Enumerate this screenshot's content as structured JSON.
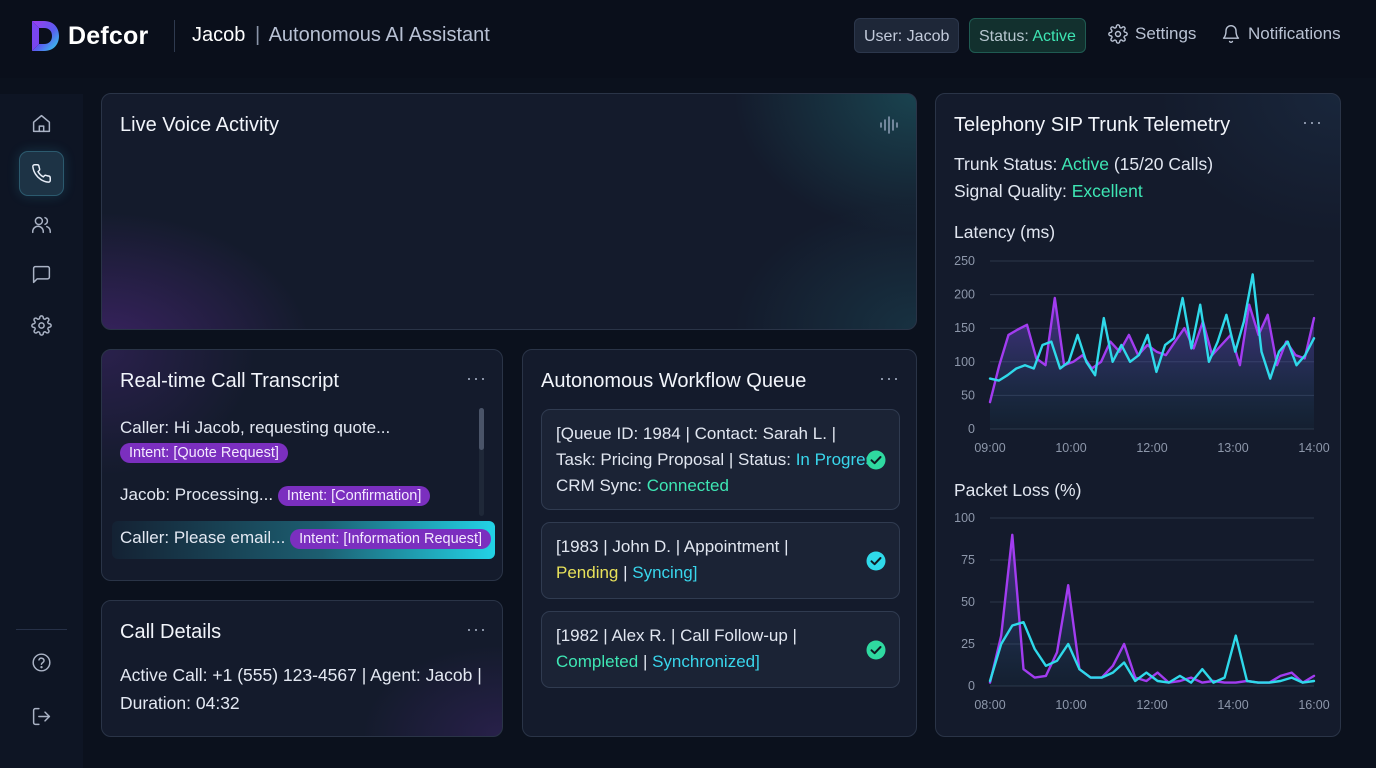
{
  "header": {
    "brand": "Defcor",
    "agent_name": "Jacob",
    "separator": "|",
    "subtitle": "Autonomous AI Assistant",
    "user_pill": "User: Jacob",
    "status_label": "Status: ",
    "status_value": "Active",
    "settings_label": "Settings",
    "notifications_label": "Notifications"
  },
  "sidebar": {
    "items": [
      {
        "icon": "home-icon",
        "active": false
      },
      {
        "icon": "phone-icon",
        "active": true
      },
      {
        "icon": "users-icon",
        "active": false
      },
      {
        "icon": "chat-icon",
        "active": false
      },
      {
        "icon": "gear-icon",
        "active": false
      }
    ],
    "bottom_items": [
      {
        "icon": "help-icon"
      },
      {
        "icon": "logout-icon"
      }
    ]
  },
  "voice_panel": {
    "title": "Live Voice Activity",
    "icon": "waveform-icon"
  },
  "transcript": {
    "title": "Real-time Call Transcript",
    "menu": "···",
    "lines": [
      {
        "text": "Caller: Hi Jacob, requesting quote...",
        "intent": "Intent: [Quote Request]"
      },
      {
        "text": "Jacob: Processing...",
        "intent": "Intent: [Confirmation]"
      },
      {
        "text": "Caller: Please email...",
        "intent": "Intent: [Information Request]"
      }
    ]
  },
  "call_details": {
    "title": "Call Details",
    "menu": "···",
    "line1": "Active Call: +1 (555) 123-4567 | Agent: Jacob |",
    "line2": "Duration: 04:32"
  },
  "workflow": {
    "title": "Autonomous Workflow Queue",
    "menu": "···",
    "items": [
      {
        "line1": "[Queue ID: 1984 | Contact: Sarah L. |",
        "line2_prefix": "Task: Pricing Proposal | Status: ",
        "line2_status": "In Progress",
        "line3_prefix": "CRM Sync: ",
        "line3_status": "Connected"
      },
      {
        "line1": "[1983 | John D. | Appointment |",
        "status": "Pending",
        "sep": " | ",
        "sync": "Syncing]"
      },
      {
        "line1": "[1982 | Alex R. | Call Follow-up |",
        "status": "Completed",
        "sep": " | ",
        "sync": "Synchronized]"
      }
    ],
    "colors": {
      "in_progress": "#39d6ec",
      "connected": "#3ee6b4",
      "pending": "#e8e15a",
      "check": "#2fd9a0"
    }
  },
  "telemetry": {
    "title": "Telephony SIP Trunk Telemetry",
    "menu": "···",
    "trunk_label": "Trunk Status: ",
    "trunk_value": "Active",
    "trunk_calls": " (15/20 Calls)",
    "signal_label": "Signal Quality: ",
    "signal_value": "Excellent"
  },
  "chart_data": [
    {
      "type": "line",
      "title": "Latency (ms)",
      "x_ticks": [
        "09:00",
        "10:00",
        "12:00",
        "13:00",
        "14:00"
      ],
      "y_ticks": [
        0,
        50,
        100,
        150,
        200,
        250
      ],
      "ylim": [
        0,
        250
      ],
      "series": [
        {
          "color": "#a23cf0",
          "values": [
            40,
            95,
            140,
            148,
            155,
            105,
            95,
            195,
            95,
            100,
            110,
            90,
            100,
            130,
            115,
            140,
            110,
            125,
            115,
            110,
            130,
            150,
            120,
            160,
            110,
            125,
            140,
            95,
            185,
            140,
            170,
            95,
            130,
            110,
            105,
            165
          ]
        },
        {
          "color": "#2fd9ea",
          "values": [
            75,
            72,
            80,
            90,
            95,
            90,
            125,
            130,
            90,
            100,
            140,
            100,
            80,
            165,
            100,
            125,
            100,
            110,
            140,
            85,
            125,
            135,
            195,
            120,
            185,
            100,
            130,
            170,
            115,
            160,
            230,
            115,
            75,
            115,
            130,
            95,
            110,
            135
          ]
        }
      ]
    },
    {
      "type": "line",
      "title": "Packet Loss (%)",
      "x_ticks": [
        "08:00",
        "10:00",
        "12:00",
        "14:00",
        "16:00"
      ],
      "y_ticks": [
        0,
        25,
        50,
        75,
        100
      ],
      "ylim": [
        0,
        100
      ],
      "series": [
        {
          "color": "#a23cf0",
          "values": [
            2,
            30,
            90,
            10,
            5,
            6,
            20,
            60,
            10,
            5,
            5,
            12,
            25,
            5,
            3,
            8,
            2,
            3,
            5,
            2,
            3,
            2,
            2,
            3,
            2,
            2,
            6,
            8,
            2,
            6
          ]
        },
        {
          "color": "#2fd9ea",
          "values": [
            3,
            25,
            36,
            38,
            22,
            12,
            15,
            25,
            10,
            5,
            5,
            8,
            14,
            3,
            8,
            3,
            2,
            6,
            2,
            10,
            2,
            5,
            30,
            3,
            2,
            2,
            3,
            5,
            2,
            3
          ]
        }
      ]
    }
  ]
}
